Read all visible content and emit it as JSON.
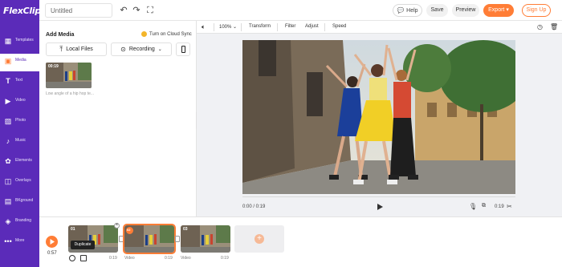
{
  "app": {
    "logo": "FlexClip",
    "project_title": "Untitled"
  },
  "topbar": {
    "help": "Help",
    "save": "Save",
    "preview": "Preview",
    "export": "Export",
    "export_chevron": "▾",
    "signup": "Sign Up"
  },
  "sidebar": {
    "items": [
      {
        "label": "Templates",
        "icon": "templates-icon"
      },
      {
        "label": "Media",
        "icon": "media-icon"
      },
      {
        "label": "Text",
        "icon": "text-icon"
      },
      {
        "label": "Video",
        "icon": "video-icon"
      },
      {
        "label": "Photo",
        "icon": "photo-icon"
      },
      {
        "label": "Music",
        "icon": "music-icon"
      },
      {
        "label": "Elements",
        "icon": "elements-icon"
      },
      {
        "label": "Overlays",
        "icon": "overlays-icon"
      },
      {
        "label": "BKground",
        "icon": "background-icon"
      },
      {
        "label": "Branding",
        "icon": "branding-icon"
      },
      {
        "label": "More",
        "icon": "more-icon"
      }
    ],
    "active": "Media"
  },
  "media_panel": {
    "title": "Add Media",
    "cloud_sync": "Turn on Cloud Sync",
    "local_files": "Local Files",
    "recording": "Recording",
    "thumb_duration": "00:19",
    "thumb_caption": "Low angle of a hip hop te..."
  },
  "edit_toolbar": {
    "zoom": "100%",
    "transform": "Transform",
    "filter": "Filter",
    "adjust": "Adjust",
    "speed": "Speed"
  },
  "player": {
    "time_current": "0:00 / 0:19",
    "duration": "0:19"
  },
  "timeline": {
    "time": "0:57",
    "tooltip": "Duplicate",
    "clips": [
      {
        "number": "01",
        "label": "",
        "duration": "0:19",
        "selected": false
      },
      {
        "number": "02",
        "label": "Video",
        "duration": "0:19",
        "selected": true
      },
      {
        "number": "03",
        "label": "Video",
        "duration": "0:19",
        "selected": false
      }
    ],
    "add_label": "+"
  },
  "colors": {
    "sidebar": "#5b2bb9",
    "accent": "#ff7d36",
    "canvas_bg": "#f0f1f4"
  }
}
